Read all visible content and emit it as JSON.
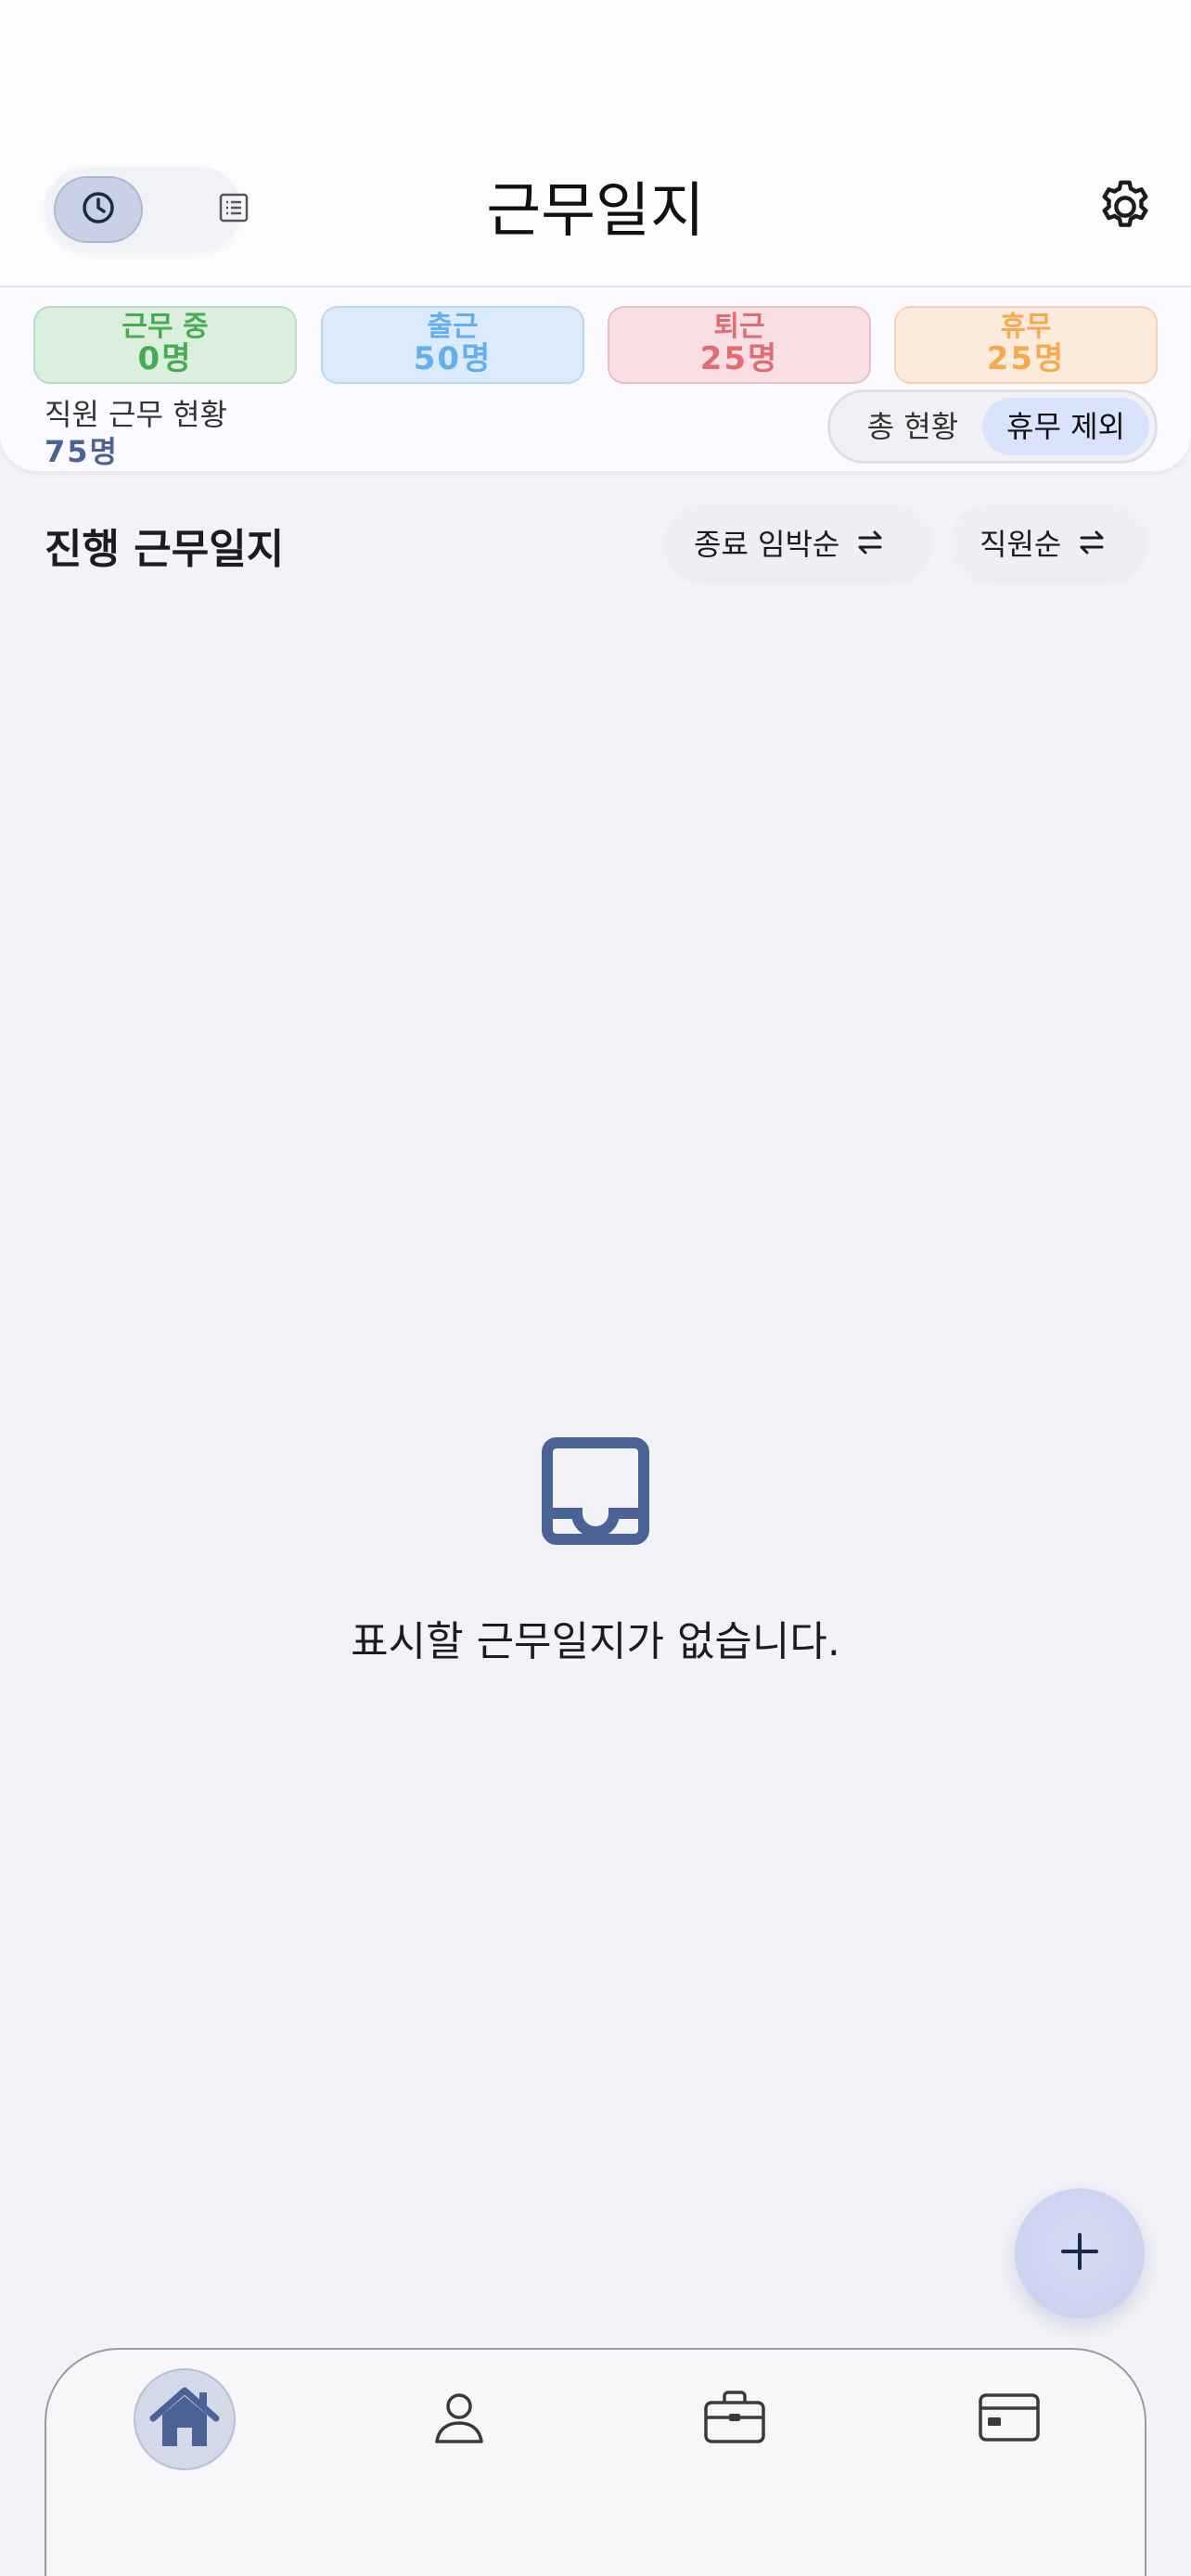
{
  "header": {
    "title": "근무일지",
    "view_toggle": [
      {
        "icon": "clock-icon",
        "active": true
      },
      {
        "icon": "list-icon",
        "active": false
      }
    ],
    "settings_icon": "gear-icon"
  },
  "status": {
    "pills": [
      {
        "label": "근무 중",
        "value": "0명",
        "color": "#4aab55"
      },
      {
        "label": "출근",
        "value": "50명",
        "color": "#62aeef"
      },
      {
        "label": "퇴근",
        "value": "25명",
        "color": "#df6d73"
      },
      {
        "label": "휴무",
        "value": "25명",
        "color": "#f7a94e"
      }
    ],
    "summary_label": "직원 근무 현황",
    "summary_value": "75명",
    "segment": {
      "options": [
        "총 현황",
        "휴무 제외"
      ],
      "selected": "휴무 제외"
    }
  },
  "section": {
    "title": "진행 근무일지",
    "sort_buttons": [
      {
        "label": "종료 임박순",
        "icon": "swap-arrows-icon"
      },
      {
        "label": "직원순",
        "icon": "swap-arrows-icon"
      }
    ]
  },
  "empty_state": {
    "icon": "inbox-icon",
    "message": "표시할 근무일지가 없습니다."
  },
  "fab": {
    "label": "+",
    "icon": "plus-icon"
  },
  "tabbar": {
    "items": [
      {
        "icon": "home-icon",
        "active": true
      },
      {
        "icon": "person-icon",
        "active": false
      },
      {
        "icon": "briefcase-icon",
        "active": false
      },
      {
        "icon": "card-icon",
        "active": false
      }
    ]
  },
  "colors": {
    "accent": "#4a6394",
    "background": "#f2f2f7"
  }
}
